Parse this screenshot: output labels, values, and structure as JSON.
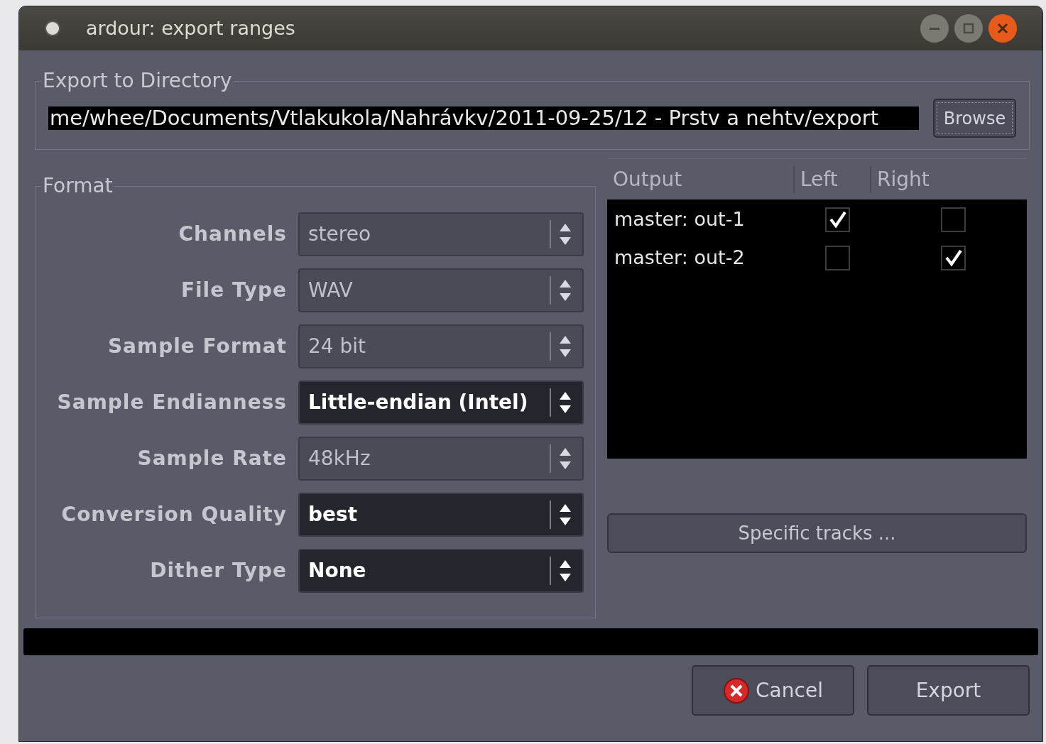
{
  "window": {
    "title": "ardour: export ranges"
  },
  "directory": {
    "legend": "Export to Directory",
    "path": "me/whee/Documents/Vtlakukola/Nahrávkv/2011-09-25/12 - Prstv a nehtv/export",
    "browse": "Browse"
  },
  "format": {
    "legend": "Format",
    "rows": [
      {
        "label": "Channels",
        "value": "stereo",
        "highlighted": false
      },
      {
        "label": "File Type",
        "value": "WAV",
        "highlighted": false
      },
      {
        "label": "Sample Format",
        "value": "24 bit",
        "highlighted": false
      },
      {
        "label": "Sample Endianness",
        "value": "Little-endian (Intel)",
        "highlighted": true
      },
      {
        "label": "Sample Rate",
        "value": "48kHz",
        "highlighted": false
      },
      {
        "label": "Conversion Quality",
        "value": "best",
        "highlighted": true
      },
      {
        "label": "Dither Type",
        "value": "None",
        "highlighted": true
      }
    ]
  },
  "outputs": {
    "columns": [
      "Output",
      "Left",
      "Right"
    ],
    "rows": [
      {
        "name": "master: out-1",
        "left": true,
        "right": false
      },
      {
        "name": "master: out-2",
        "left": false,
        "right": true
      }
    ],
    "specific_tracks": "Specific tracks ..."
  },
  "progress": {
    "level": 0
  },
  "buttons": [
    {
      "label": "Cancel",
      "kind": "cancel"
    },
    {
      "label": "Export",
      "kind": "plain"
    }
  ]
}
